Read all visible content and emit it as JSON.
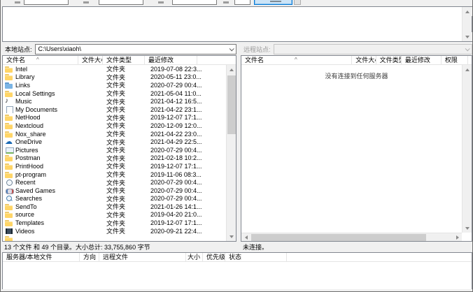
{
  "local_panel": {
    "site_label": "本地站点:",
    "path": "C:\\Users\\xiaoh\\",
    "columns": [
      "文件名",
      "文件大小",
      "文件类型",
      "最近修改"
    ],
    "folder_type": "文件夹",
    "files": [
      {
        "name": "Intel",
        "icon": "folder",
        "type": "文件夹",
        "modified": "2019-07-08 22:3..."
      },
      {
        "name": "Library",
        "icon": "folder",
        "type": "文件夹",
        "modified": "2020-05-11 23:0..."
      },
      {
        "name": "Links",
        "icon": "links",
        "type": "文件夹",
        "modified": "2020-07-29 00:4..."
      },
      {
        "name": "Local Settings",
        "icon": "folder",
        "type": "文件夹",
        "modified": "2021-05-04 11:0..."
      },
      {
        "name": "Music",
        "icon": "music",
        "type": "文件夹",
        "modified": "2021-04-12 16:5..."
      },
      {
        "name": "My Documents",
        "icon": "docs",
        "type": "文件夹",
        "modified": "2021-04-22 23:1..."
      },
      {
        "name": "NetHood",
        "icon": "folder",
        "type": "文件夹",
        "modified": "2019-12-07 17:1..."
      },
      {
        "name": "Nextcloud",
        "icon": "folder",
        "type": "文件夹",
        "modified": "2020-12-09 12:0..."
      },
      {
        "name": "Nox_share",
        "icon": "folder",
        "type": "文件夹",
        "modified": "2021-04-22 23:0..."
      },
      {
        "name": "OneDrive",
        "icon": "onedrive",
        "type": "文件夹",
        "modified": "2021-04-29 22:5..."
      },
      {
        "name": "Pictures",
        "icon": "pictures",
        "type": "文件夹",
        "modified": "2020-07-29 00:4..."
      },
      {
        "name": "Postman",
        "icon": "folder",
        "type": "文件夹",
        "modified": "2021-02-18 10:2..."
      },
      {
        "name": "PrintHood",
        "icon": "folder",
        "type": "文件夹",
        "modified": "2019-12-07 17:1..."
      },
      {
        "name": "pt-program",
        "icon": "folder",
        "type": "文件夹",
        "modified": "2019-11-06 08:3..."
      },
      {
        "name": "Recent",
        "icon": "recent",
        "type": "文件夹",
        "modified": "2020-07-29 00:4..."
      },
      {
        "name": "Saved Games",
        "icon": "games",
        "type": "文件夹",
        "modified": "2020-07-29 00:4..."
      },
      {
        "name": "Searches",
        "icon": "searches",
        "type": "文件夹",
        "modified": "2020-07-29 00:4..."
      },
      {
        "name": "SendTo",
        "icon": "folder",
        "type": "文件夹",
        "modified": "2021-01-26 14:1..."
      },
      {
        "name": "source",
        "icon": "folder",
        "type": "文件夹",
        "modified": "2019-04-20 21:0..."
      },
      {
        "name": "Templates",
        "icon": "folder",
        "type": "文件夹",
        "modified": "2019-12-07 17:1..."
      },
      {
        "name": "Videos",
        "icon": "videos",
        "type": "文件夹",
        "modified": "2020-09-21 22:4..."
      },
      {
        "name": "",
        "icon": "folder",
        "type": "",
        "modified": ""
      }
    ],
    "status": "13 个文件 和 49 个目录。大小总计: 33,755,860 字节"
  },
  "remote_panel": {
    "site_label": "远程站点:",
    "path": "",
    "columns": [
      "文件名",
      "文件大小",
      "文件类型",
      "最近修改",
      "权限"
    ],
    "empty_message": "没有连接到任何服务器",
    "status": "未连接。"
  },
  "queue_panel": {
    "columns": [
      "服务器/本地文件",
      "方向",
      "远程文件",
      "大小",
      "优先级",
      "状态"
    ]
  },
  "colors": {
    "accent_focus": "#0078d7",
    "folder_yellow": "#ffd567",
    "panel_border": "#828790"
  }
}
